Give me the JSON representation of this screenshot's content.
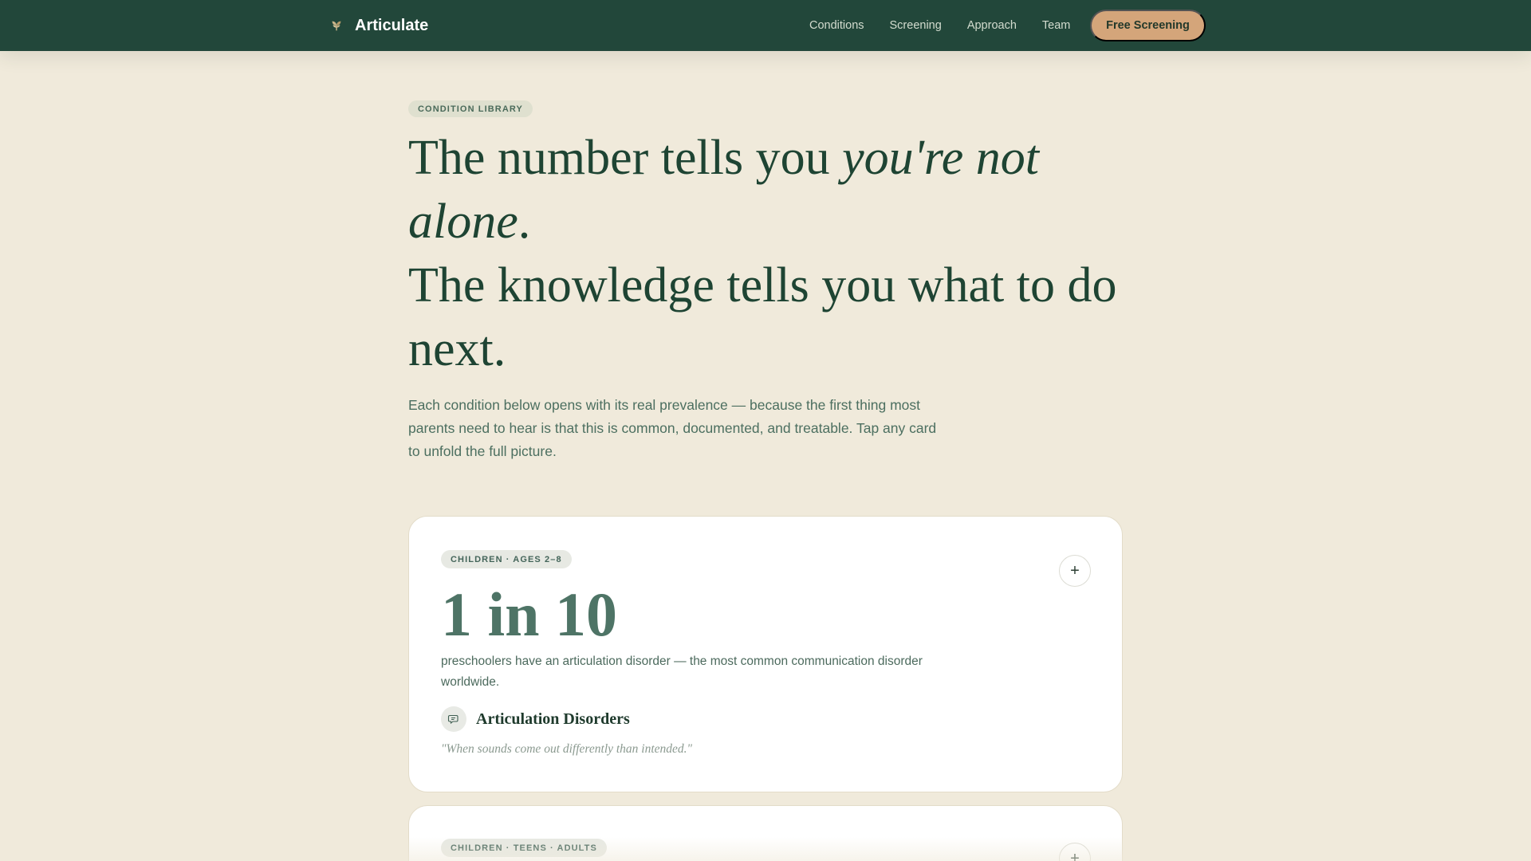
{
  "nav": {
    "brand": "Articulate",
    "links": [
      "Conditions",
      "Screening",
      "Approach",
      "Team"
    ],
    "cta": "Free Screening"
  },
  "hero": {
    "eyebrow": "CONDITION LIBRARY",
    "title_part1": "The number tells you ",
    "title_italic": "you're not alone",
    "title_part2": ".",
    "title_line2": "The knowledge tells you what to do next.",
    "lead": "Each condition below opens with its real prevalence — because the first thing most parents need to hear is that this is common, documented, and treatable. Tap any card to unfold the full picture."
  },
  "cards": [
    {
      "tag": "CHILDREN · AGES 2–8",
      "stat": "1 in 10",
      "description": "preschoolers have an articulation disorder — the most common communication disorder worldwide.",
      "condition": "Articulation Disorders",
      "quote": "\"When sounds come out differently than intended.\"",
      "toggle": "+"
    },
    {
      "tag": "CHILDREN · TEENS · ADULTS",
      "toggle": "+"
    }
  ],
  "colors": {
    "nav_bg": "#22473a",
    "page_bg": "#f0eadb",
    "accent": "#d4a57a",
    "stat": "#4e7466"
  }
}
